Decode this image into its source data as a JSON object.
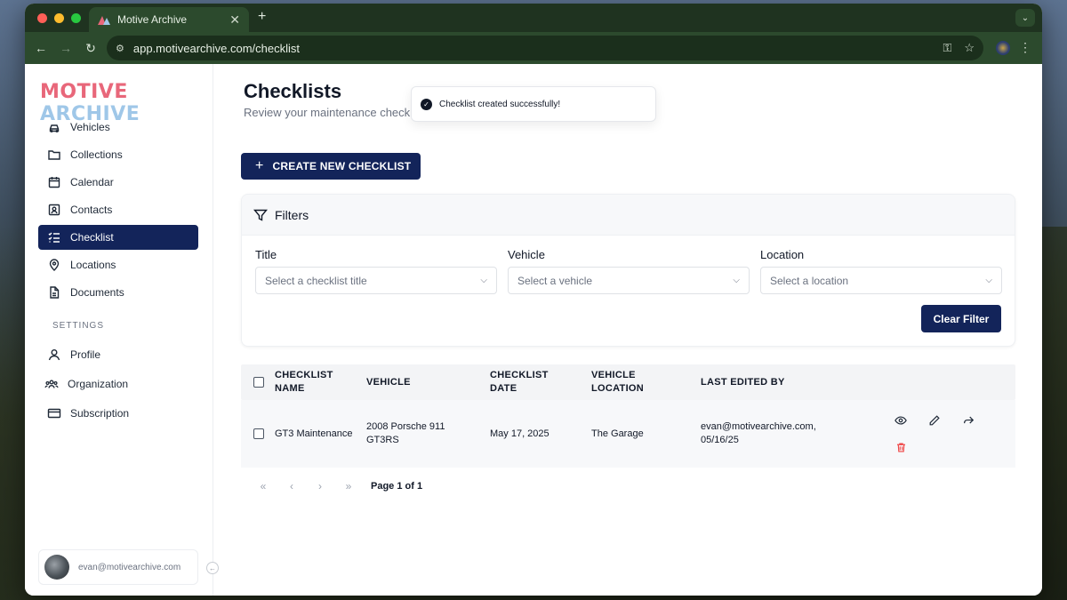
{
  "browser": {
    "tab_title": "Motive Archive",
    "url": "app.motivearchive.com/checklist"
  },
  "brand": {
    "logo_part1": "MOTIVE",
    "logo_part2": "ARCHIVE"
  },
  "sidebar": {
    "items": [
      {
        "label": "Vehicles",
        "icon": "car-icon"
      },
      {
        "label": "Collections",
        "icon": "folder-icon"
      },
      {
        "label": "Calendar",
        "icon": "calendar-icon"
      },
      {
        "label": "Contacts",
        "icon": "contact-card-icon"
      },
      {
        "label": "Checklist",
        "icon": "checklist-icon",
        "active": true
      },
      {
        "label": "Locations",
        "icon": "map-pin-icon"
      },
      {
        "label": "Documents",
        "icon": "document-icon"
      }
    ],
    "settings_header": "SETTINGS",
    "settings_items": [
      {
        "label": "Profile",
        "icon": "user-icon"
      },
      {
        "label": "Organization",
        "icon": "team-icon"
      },
      {
        "label": "Subscription",
        "icon": "credit-card-icon"
      }
    ],
    "user_email": "evan@motivearchive.com"
  },
  "page": {
    "title": "Checklists",
    "subtitle": "Review your maintenance checkli"
  },
  "toast": {
    "message": "Checklist created successfully!"
  },
  "create_button": "CREATE NEW CHECKLIST",
  "filters": {
    "header": "Filters",
    "fields": [
      {
        "label": "Title",
        "placeholder": "Select a checklist title"
      },
      {
        "label": "Vehicle",
        "placeholder": "Select a vehicle"
      },
      {
        "label": "Location",
        "placeholder": "Select a location"
      }
    ],
    "clear_button": "Clear Filter"
  },
  "table": {
    "headers": {
      "name_1": "CHECKLIST",
      "name_2": "NAME",
      "vehicle": "VEHICLE",
      "date_1": "CHECKLIST",
      "date_2": "DATE",
      "loc_1": "VEHICLE",
      "loc_2": "LOCATION",
      "edited": "LAST EDITED BY"
    },
    "rows": [
      {
        "name": "GT3 Maintenance",
        "vehicle_1": "2008 Porsche 911",
        "vehicle_2": "GT3RS",
        "date": "May 17, 2025",
        "location": "The Garage",
        "edited_1": "evan@motivearchive.com,",
        "edited_2": "05/16/25"
      }
    ]
  },
  "pagination": {
    "info": "Page 1 of 1"
  },
  "colors": {
    "primary": "#13245a",
    "delete": "#ef4444",
    "logo_red": "#e8677a",
    "logo_blue": "#9fc7e8"
  }
}
